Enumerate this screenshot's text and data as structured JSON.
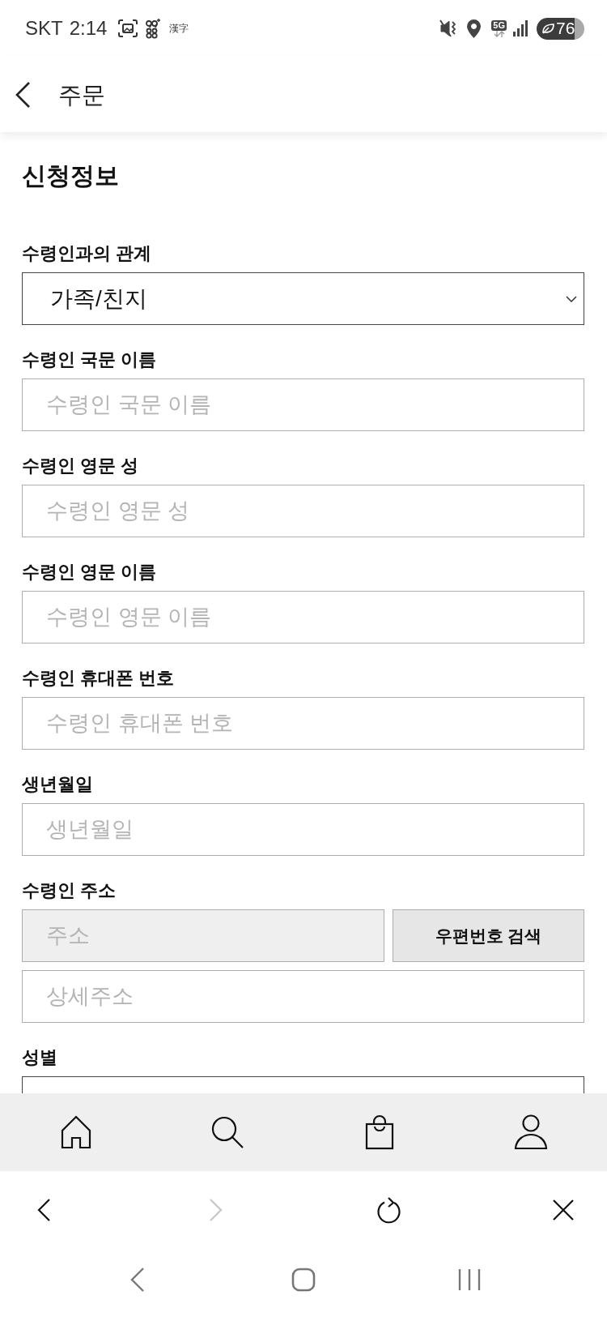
{
  "status_bar": {
    "carrier": "SKT",
    "time": "2:14",
    "ime": "漢字",
    "network": "5G",
    "battery": "76"
  },
  "header": {
    "title": "주문"
  },
  "section_title": "신청정보",
  "fields": [
    {
      "kind": "select",
      "label": "수령인과의 관계",
      "value": "가족/친지",
      "clipped": false
    },
    {
      "kind": "text",
      "label": "수령인 국문 이름",
      "placeholder": "수령인 국문 이름"
    },
    {
      "kind": "text",
      "label": "수령인 영문 성",
      "placeholder": "수령인 영문 성"
    },
    {
      "kind": "text",
      "label": "수령인 영문 이름",
      "placeholder": "수령인 영문 이름"
    },
    {
      "kind": "text",
      "label": "수령인 휴대폰 번호",
      "placeholder": "수령인 휴대폰 번호"
    },
    {
      "kind": "text",
      "label": "생년월일",
      "placeholder": "생년월일"
    },
    {
      "kind": "address",
      "label": "수령인 주소",
      "address": {
        "placeholder": "주소",
        "disabled": true
      },
      "search_button": "우편번호 검색",
      "detail": {
        "placeholder": "상세주소"
      }
    },
    {
      "kind": "select",
      "label": "성별",
      "clipped": true
    }
  ],
  "browser_toolbar": {
    "back": {
      "disabled": false
    },
    "forward": {
      "disabled": true
    }
  }
}
